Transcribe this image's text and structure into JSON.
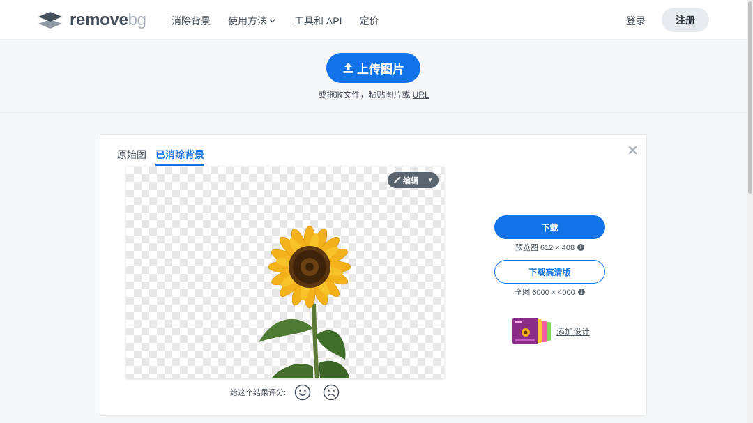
{
  "header": {
    "logo_text": "remove",
    "logo_text_bg": "bg",
    "nav": [
      "消除背景",
      "使用方法",
      "工具和 API",
      "定价"
    ],
    "login": "登录",
    "signup": "注册"
  },
  "upload": {
    "button_label": "上传图片",
    "hint_prefix": "或拖放文件，粘贴图片或",
    "hint_url": "URL"
  },
  "result": {
    "tabs": [
      "原始图",
      "已消除背景"
    ],
    "active_tab": "已消除背景",
    "edit_label": "编辑",
    "rating_prompt": "给这个结果评分:",
    "download_label": "下载",
    "preview_info": "预览图 612 × 408",
    "download_hd_label": "下载高清版",
    "full_info": "全图 6000 × 4000",
    "add_design_label": "添加设计"
  },
  "colors": {
    "accent": "#1273e8",
    "text": "#454f5b",
    "background": "#f6f7f9"
  },
  "icons": [
    "logo-layers-icon",
    "chevron-down-icon",
    "upload-icon",
    "close-icon",
    "brush-icon",
    "caret-down-icon",
    "info-icon",
    "smile-icon",
    "frown-icon"
  ]
}
